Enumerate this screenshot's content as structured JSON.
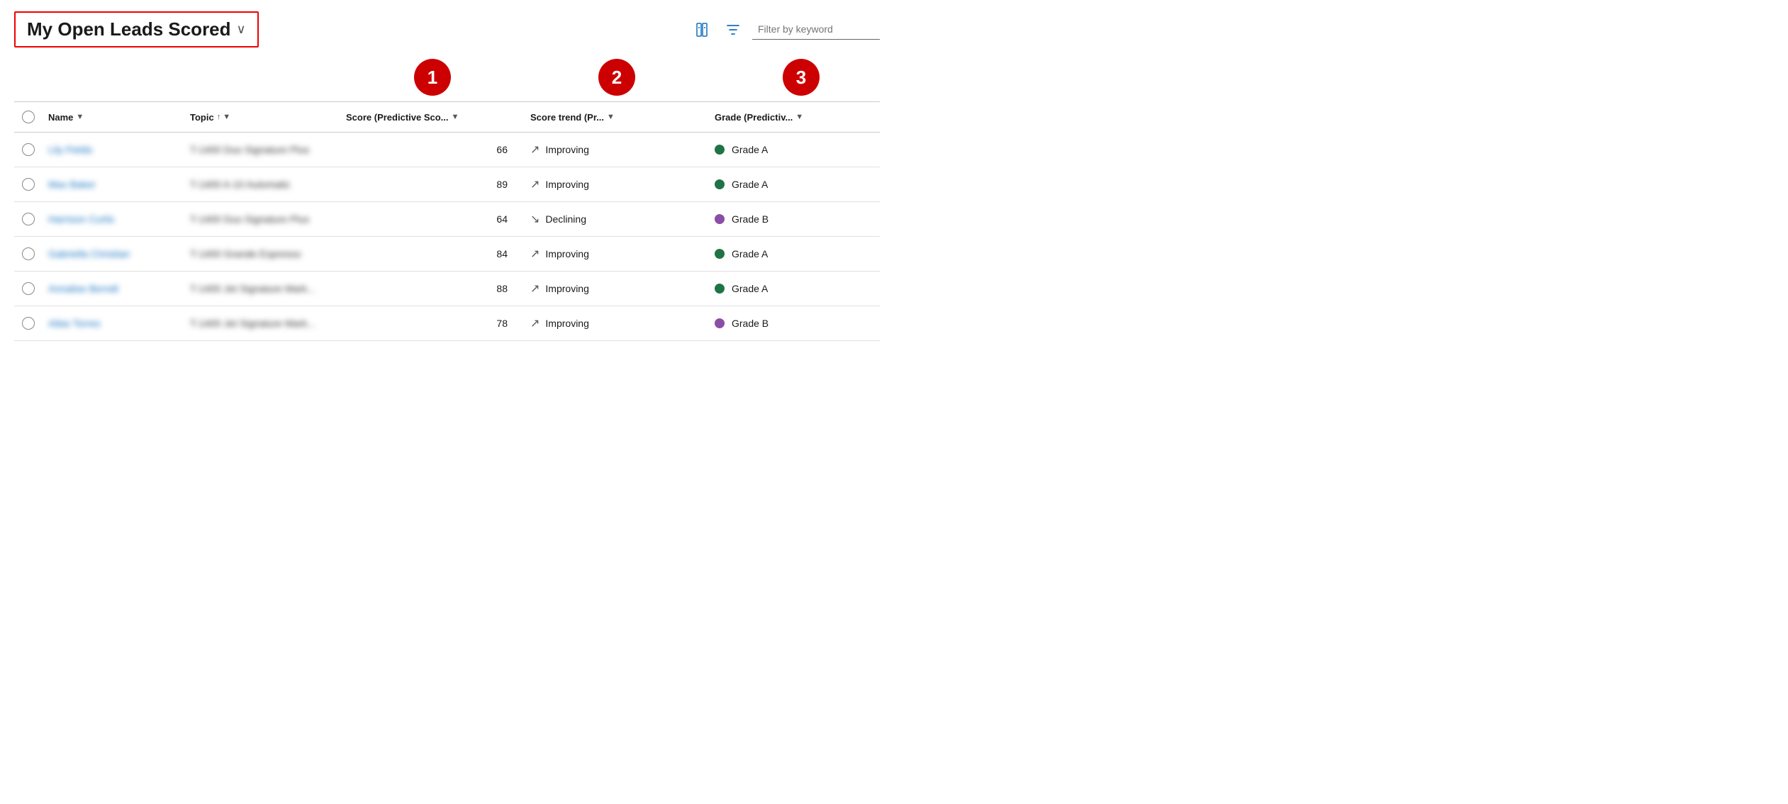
{
  "header": {
    "title": "My Open Leads Scored",
    "chevron": "∨",
    "filter_placeholder": "Filter by keyword"
  },
  "icons": {
    "settings_icon": "⊞",
    "filter_icon": "⋁"
  },
  "badges": [
    {
      "id": "badge1",
      "number": "1",
      "col_index": 3
    },
    {
      "id": "badge2",
      "number": "2",
      "col_index": 4
    },
    {
      "id": "badge3",
      "number": "3",
      "col_index": 5
    }
  ],
  "columns": [
    {
      "id": "checkbox",
      "label": ""
    },
    {
      "id": "name",
      "label": "Name",
      "sort": "▼"
    },
    {
      "id": "topic",
      "label": "Topic",
      "sort": "↑ ▼"
    },
    {
      "id": "score",
      "label": "Score (Predictive Sco...",
      "sort": "▼"
    },
    {
      "id": "trend",
      "label": "Score trend (Pr...",
      "sort": "▼"
    },
    {
      "id": "grade",
      "label": "Grade (Predictiv...",
      "sort": "▼"
    }
  ],
  "rows": [
    {
      "name": "Lily Fields",
      "topic": "T-1400 Duo Signature Plus",
      "score": "66",
      "trend_arrow": "↗",
      "trend_label": "Improving",
      "grade_color": "green",
      "grade_label": "Grade A"
    },
    {
      "name": "Max Baker",
      "topic": "T-1400 A-10 Automatic",
      "score": "89",
      "trend_arrow": "↗",
      "trend_label": "Improving",
      "grade_color": "green",
      "grade_label": "Grade A"
    },
    {
      "name": "Harrison Curtis",
      "topic": "T-1400 Duo Signature Plus",
      "score": "64",
      "trend_arrow": "↘",
      "trend_label": "Declining",
      "grade_color": "purple",
      "grade_label": "Grade B"
    },
    {
      "name": "Gabriella Christian",
      "topic": "T-1400 Grande Espresso",
      "score": "84",
      "trend_arrow": "↗",
      "trend_label": "Improving",
      "grade_color": "green",
      "grade_label": "Grade A"
    },
    {
      "name": "Annalise Berndt",
      "topic": "T-1400 Jet Signature Mark...",
      "score": "88",
      "trend_arrow": "↗",
      "trend_label": "Improving",
      "grade_color": "green",
      "grade_label": "Grade A"
    },
    {
      "name": "Atlas Torres",
      "topic": "T-1400 Jet Signature Mark...",
      "score": "78",
      "trend_arrow": "↗",
      "trend_label": "Improving",
      "grade_color": "purple",
      "grade_label": "Grade B"
    }
  ]
}
